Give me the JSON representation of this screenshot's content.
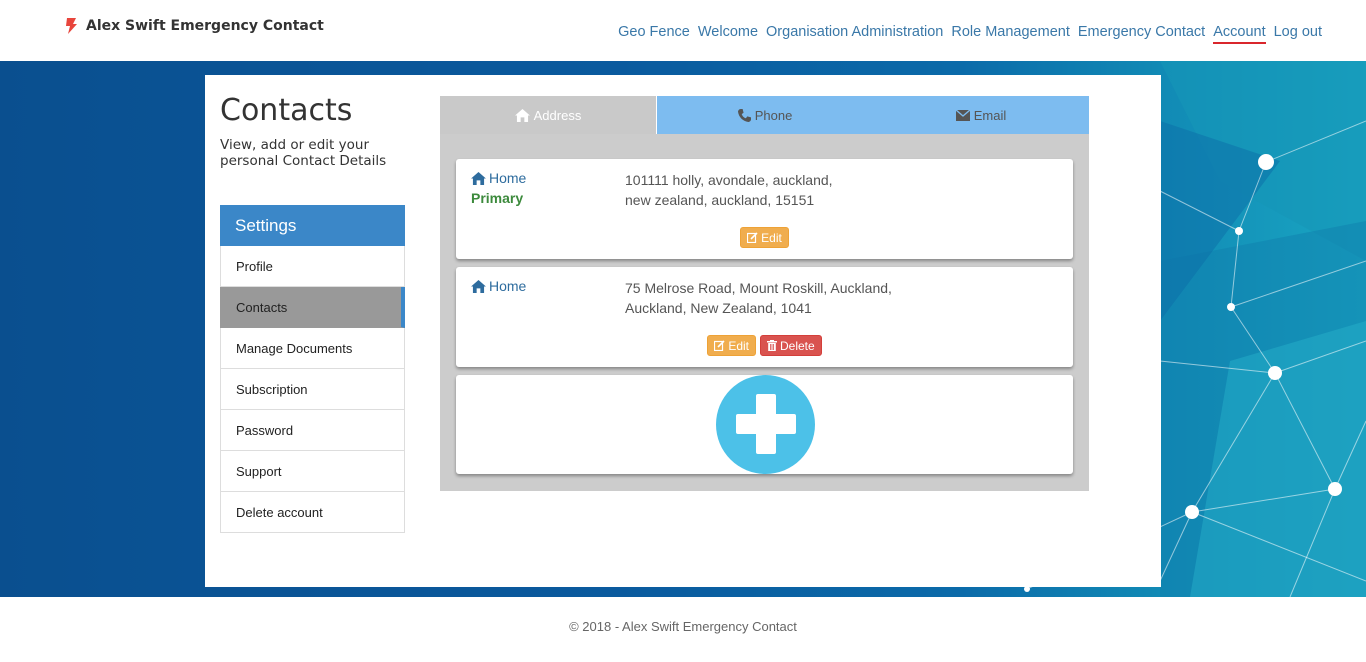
{
  "brand": {
    "name": "Alex Swift Emergency Contact"
  },
  "nav": {
    "items": [
      {
        "label": "Geo Fence"
      },
      {
        "label": "Welcome"
      },
      {
        "label": "Organisation Administration"
      },
      {
        "label": "Role Management"
      },
      {
        "label": "Emergency Contact"
      },
      {
        "label": "Account",
        "active": true
      },
      {
        "label": "Log out"
      }
    ]
  },
  "page": {
    "title": "Contacts",
    "subtitle": "View, add or edit your personal Contact Details"
  },
  "settings": {
    "heading": "Settings",
    "items": [
      {
        "label": "Profile"
      },
      {
        "label": "Contacts",
        "active": true
      },
      {
        "label": "Manage Documents"
      },
      {
        "label": "Subscription"
      },
      {
        "label": "Password"
      },
      {
        "label": "Support"
      },
      {
        "label": "Delete account"
      }
    ]
  },
  "tabs": [
    {
      "label": "Address",
      "icon": "home-icon",
      "active": true
    },
    {
      "label": "Phone",
      "icon": "phone-icon"
    },
    {
      "label": "Email",
      "icon": "envelope-icon"
    }
  ],
  "addresses": [
    {
      "type": "Home",
      "primary_label": "Primary",
      "line1": "101111 holly, avondale, auckland,",
      "line2": "new zealand, auckland, 15151",
      "edit_label": "Edit"
    },
    {
      "type": "Home",
      "line1": "75 Melrose Road, Mount Roskill, Auckland,",
      "line2": "Auckland, New Zealand, 1041",
      "edit_label": "Edit",
      "delete_label": "Delete"
    }
  ],
  "footer": {
    "text": "© 2018 - Alex Swift Emergency Contact"
  },
  "colors": {
    "link": "#3a78a8",
    "active_underline": "#d9262c",
    "settings_header": "#3b87c8",
    "tab_active": "#c9c9c9",
    "tab_inactive": "#7dbcf0",
    "primary_text": "#3c8a3c",
    "edit_button": "#f0ad4e",
    "delete_button": "#d9534f",
    "add_button": "#4cc1e8"
  }
}
